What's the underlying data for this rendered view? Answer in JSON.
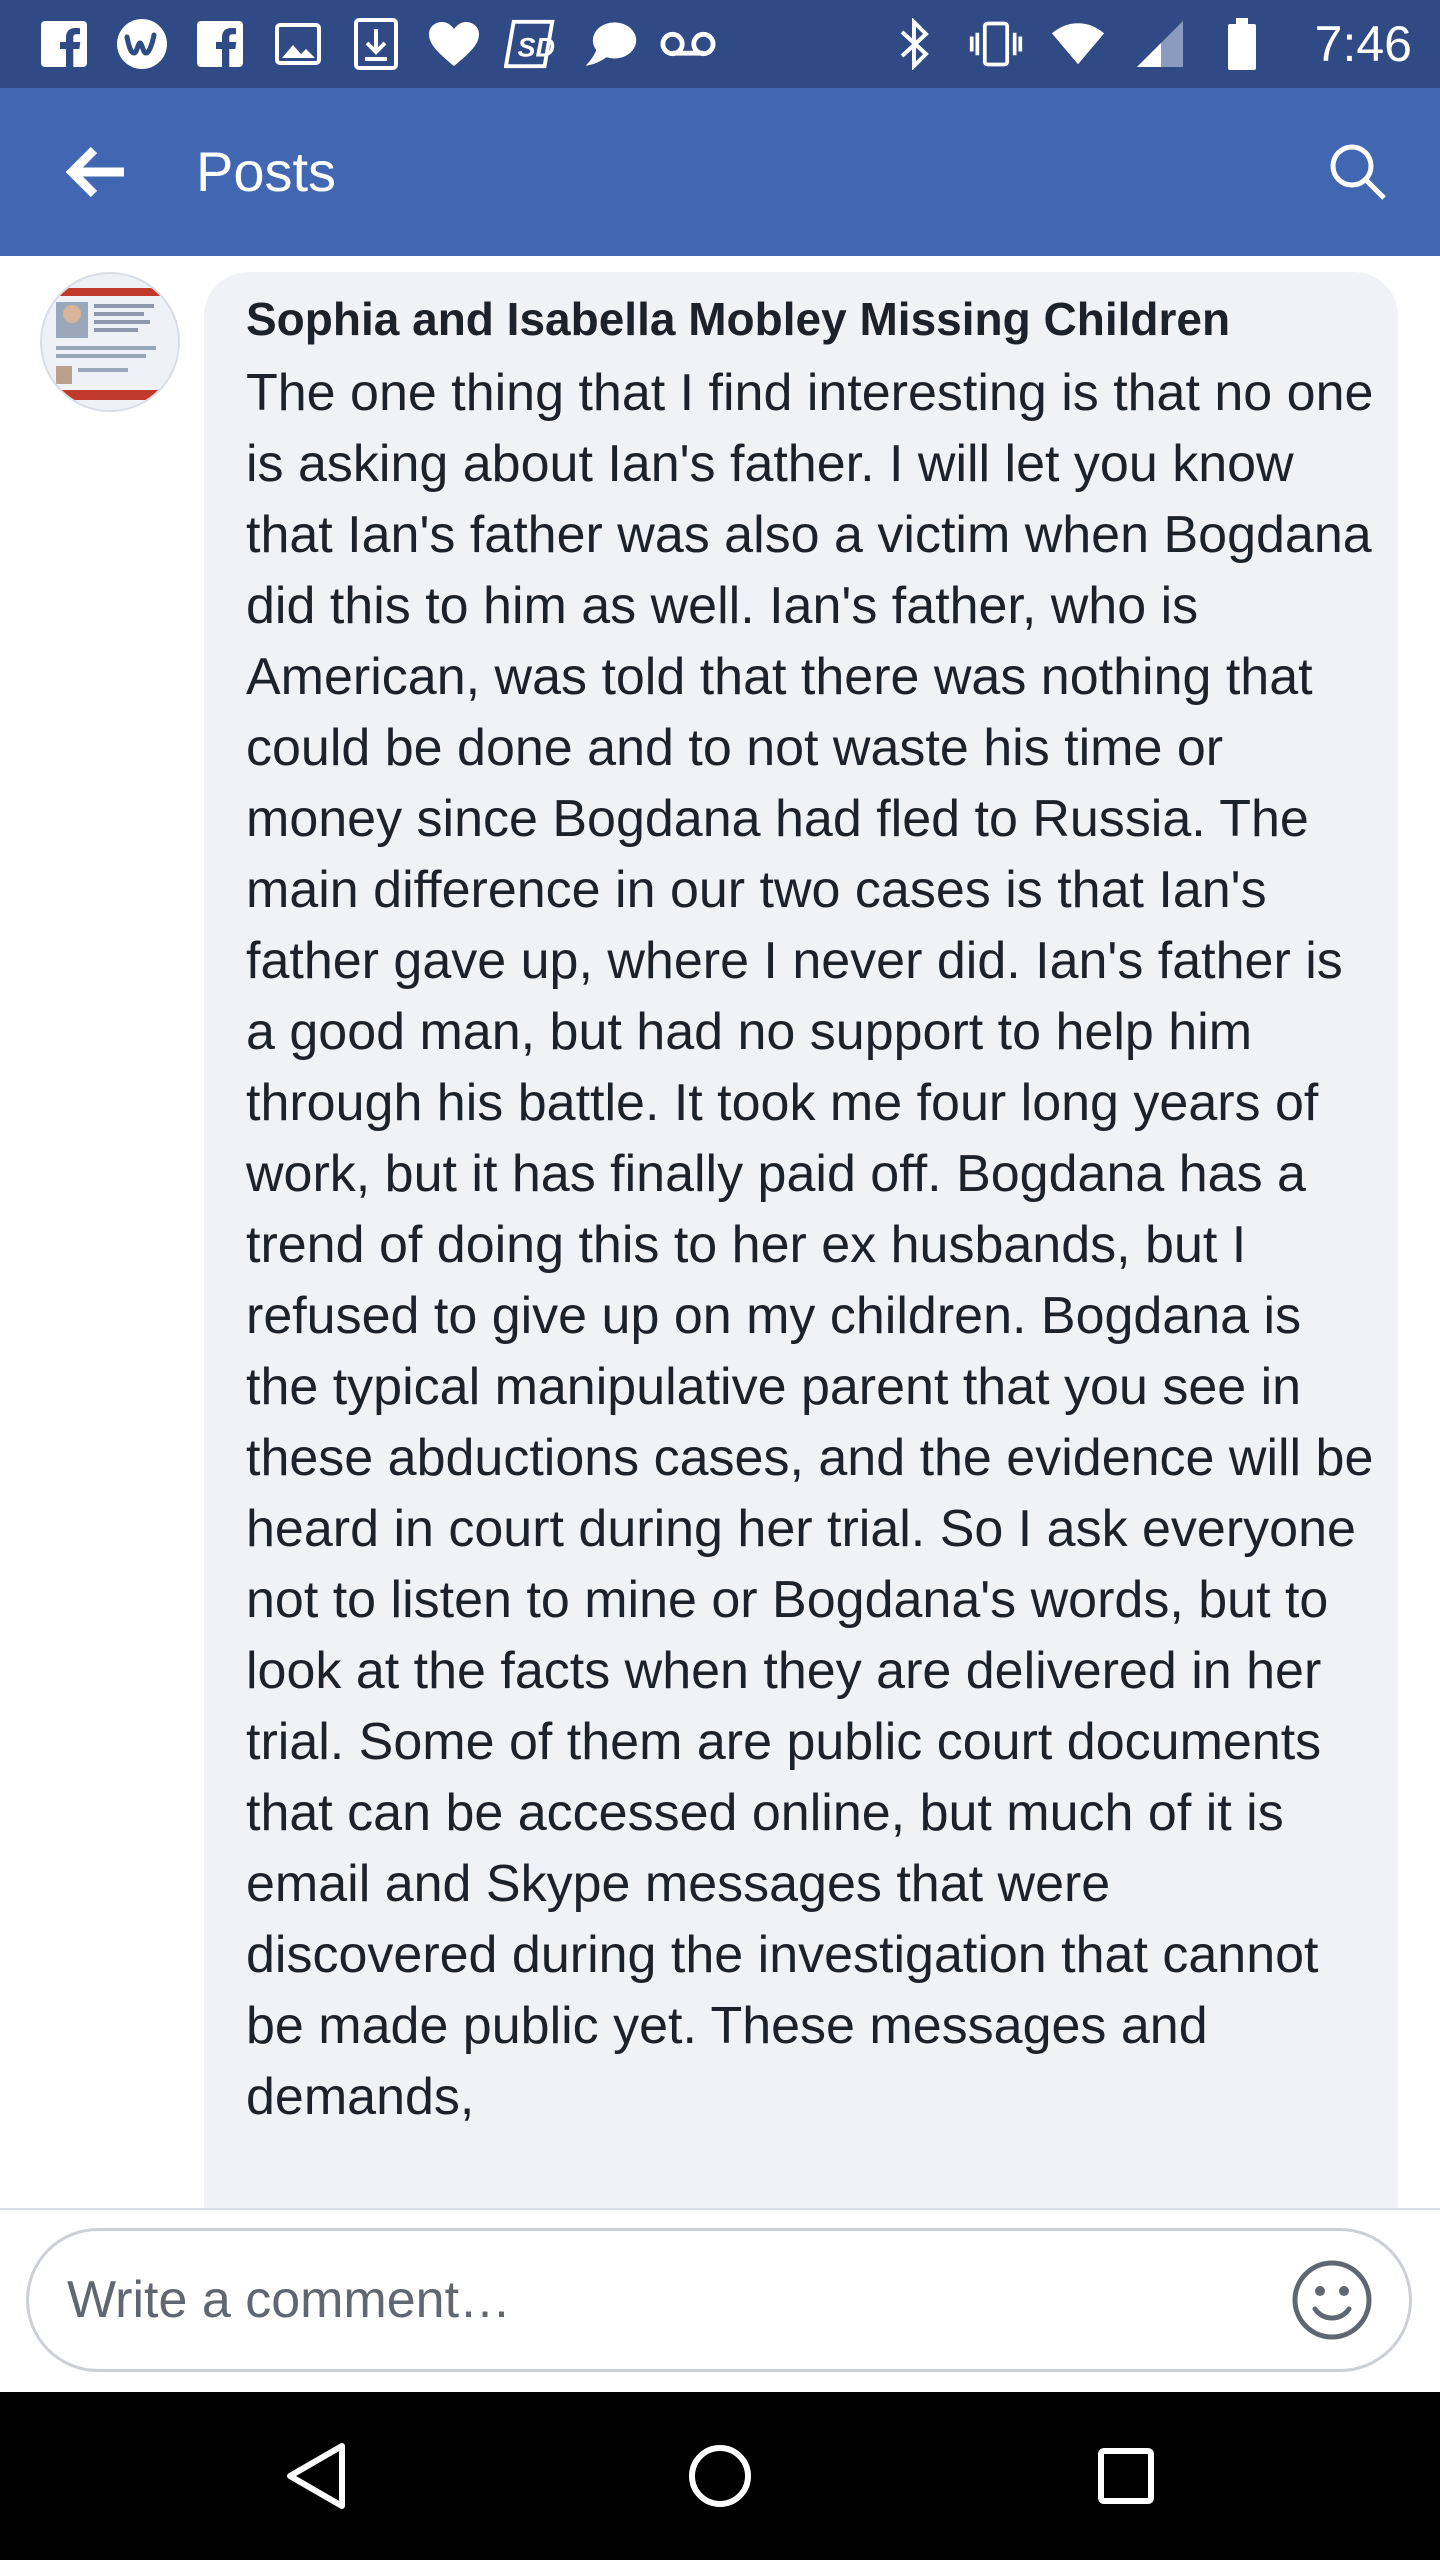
{
  "status_bar": {
    "time": "7:46",
    "left_icons": [
      "facebook-icon",
      "wattpad-icon",
      "facebook-icon",
      "image-icon",
      "download-icon",
      "heart-icon",
      "sd-icon",
      "chat-bubble-icon",
      "voicemail-icon"
    ],
    "right_icons": [
      "bluetooth-icon",
      "vibrate-icon",
      "wifi-icon",
      "signal-icon",
      "battery-icon"
    ]
  },
  "app_bar": {
    "title": "Posts"
  },
  "comment": {
    "author": "Sophia and Isabella Mobley Missing Children",
    "text": "The one thing that I find interesting is that no one is asking about Ian's father. I will let you know that Ian's father was also a victim when Bogdana did this to him as well. Ian's father, who is American, was told that there was nothing that could be done and to not waste his time or money since Bogdana had fled to Russia. The main difference in our two cases is that Ian's father gave up, where I never did. Ian's father is a good man, but had no support to help him through his battle. It took me four long years of work, but it has finally paid off. Bogdana has a trend of doing this to her ex husbands, but I refused to give up on my children. Bogdana is the typical manipulative parent that you see in these abductions cases, and the evidence will be heard in court during her trial. So I ask everyone not to listen to mine or Bogdana's words, but to look at the facts when they are delivered in her trial. Some of them are public court documents that can be accessed online, but much of it is email and Skype messages that were discovered during the investigation that cannot be made public yet. These messages and demands,"
  },
  "composer": {
    "placeholder": "Write a comment…"
  },
  "colors": {
    "status_bar": "#2f4a84",
    "app_bar": "#4267b2",
    "bubble": "#f1f2f6",
    "nav_bar": "#000000"
  }
}
